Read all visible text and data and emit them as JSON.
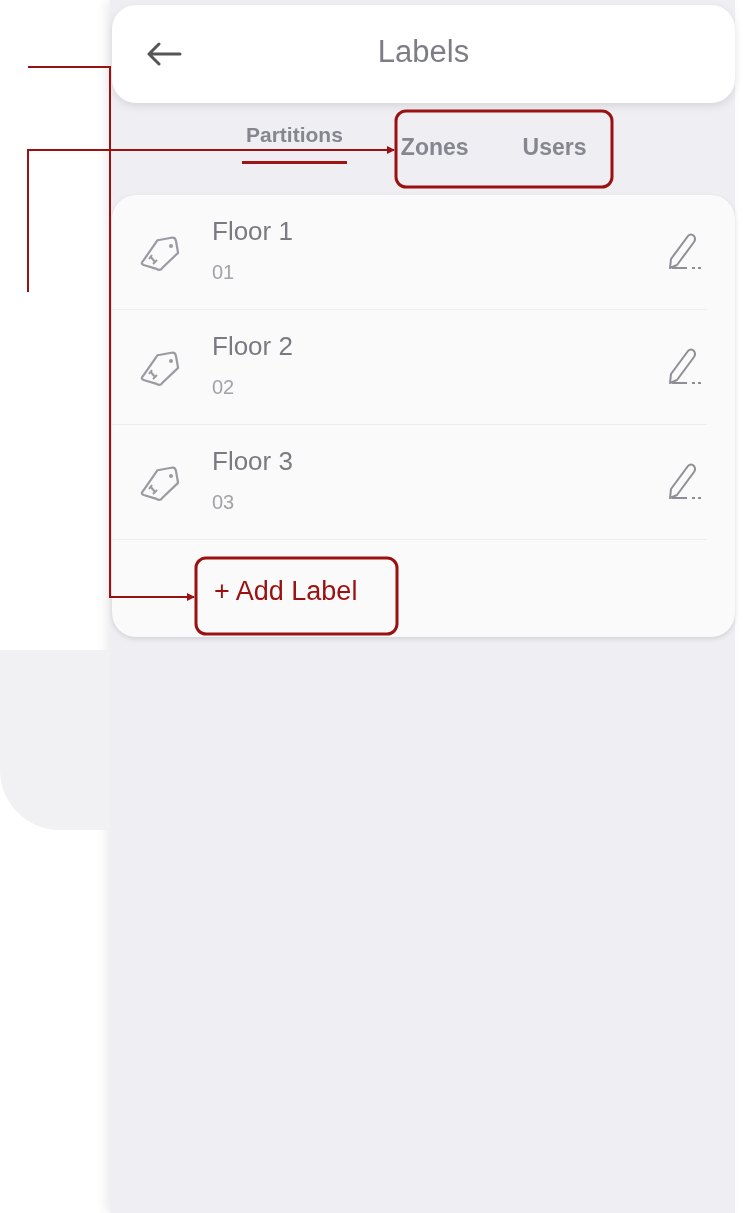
{
  "header": {
    "title": "Labels"
  },
  "tabs": [
    {
      "label": "Partitions",
      "selected": true
    },
    {
      "label": "Zones",
      "selected": false
    },
    {
      "label": "Users",
      "selected": false
    }
  ],
  "labels": [
    {
      "name": "Floor 1",
      "code": "01"
    },
    {
      "name": "Floor 2",
      "code": "02"
    },
    {
      "name": "Floor 3",
      "code": "03"
    }
  ],
  "add_button": "+ Add Label"
}
